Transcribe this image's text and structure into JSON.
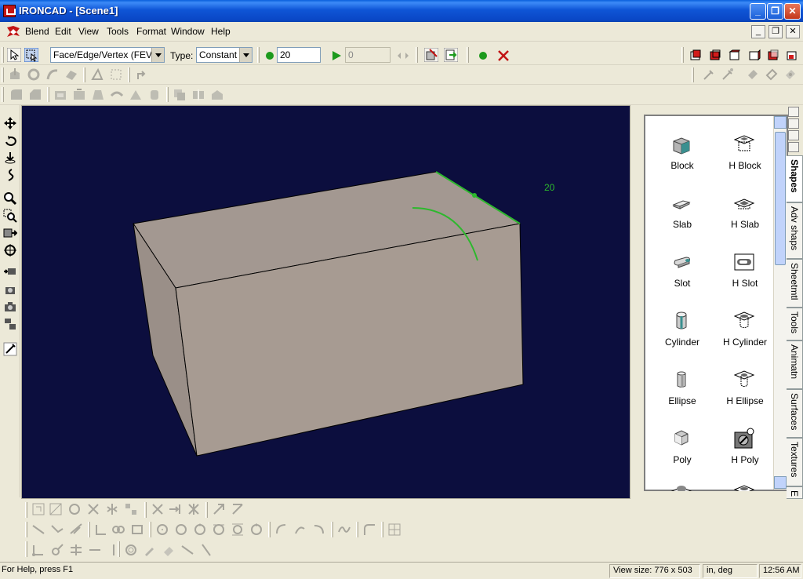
{
  "window": {
    "title": "IRONCAD - [Scene1]"
  },
  "menu": {
    "items": [
      "Blend",
      "Edit",
      "View",
      "Tools",
      "Format",
      "Window",
      "Help"
    ]
  },
  "blend_toolbar": {
    "selection_filter": "Face/Edge/Vertex (FEV)",
    "type_label": "Type:",
    "type_value": "Constant",
    "radius_value": "20",
    "second_value": "0"
  },
  "viewport": {
    "dimension_label": "20",
    "background": "#0c0e3e",
    "block_color": "#a79b92",
    "accent": "#2db82d"
  },
  "catalog": {
    "tabs": [
      "Shapes",
      "Adv shaps",
      "Sheetmtl",
      "Tools",
      "Animatn",
      "Surfaces",
      "Textures",
      "E"
    ],
    "shapes": [
      {
        "name": "Block",
        "icon": "block-icon"
      },
      {
        "name": "H Block",
        "icon": "hollow-block-icon"
      },
      {
        "name": "Slab",
        "icon": "slab-icon"
      },
      {
        "name": "H Slab",
        "icon": "hollow-slab-icon"
      },
      {
        "name": "Slot",
        "icon": "slot-icon"
      },
      {
        "name": "H Slot",
        "icon": "hollow-slot-icon"
      },
      {
        "name": "Cylinder",
        "icon": "cylinder-icon"
      },
      {
        "name": "H Cylinder",
        "icon": "hollow-cylinder-icon"
      },
      {
        "name": "Ellipse",
        "icon": "ellipse-icon"
      },
      {
        "name": "H Ellipse",
        "icon": "hollow-ellipse-icon"
      },
      {
        "name": "Poly",
        "icon": "poly-icon"
      },
      {
        "name": "H Poly",
        "icon": "hollow-poly-icon"
      }
    ]
  },
  "status": {
    "help": "For Help, press F1",
    "view_size": "View size:  776 x 503",
    "units": "in, deg",
    "time": "12:56 AM"
  }
}
